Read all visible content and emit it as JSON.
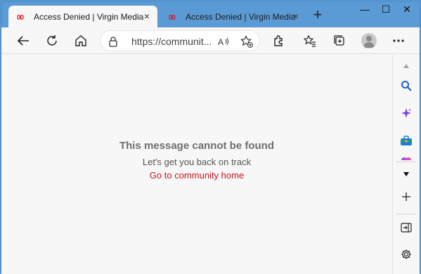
{
  "tabs": [
    {
      "title": "Access Denied | Virgin Media C",
      "active": true,
      "favicon": "virgin-media-favicon"
    },
    {
      "title": "Access Denied | Virgin Media C",
      "active": false,
      "favicon": "virgin-media-favicon"
    }
  ],
  "window_controls": {
    "minimize": "—",
    "maximize": "☐",
    "close": "✕"
  },
  "toolbar": {
    "url": "https://communit..."
  },
  "page": {
    "title": "This message cannot be found",
    "subtitle": "Let's get you back on track",
    "link": "Go to community home"
  },
  "colors": {
    "titlebar": "#5b9bd5",
    "link": "#c8141f",
    "brand": "#d51b29"
  }
}
